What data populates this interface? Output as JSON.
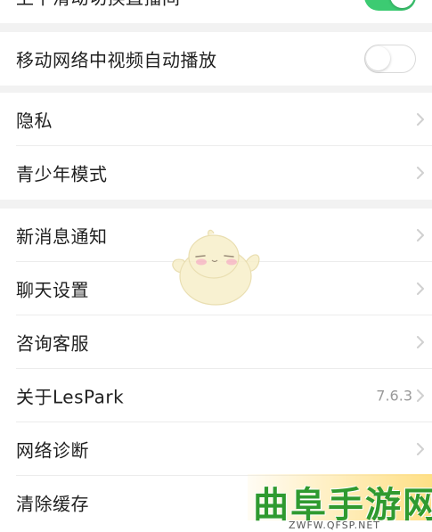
{
  "settings": {
    "top_toggle": {
      "label": "上下滑动切换直播间",
      "state": "on"
    },
    "mobile_autoplay": {
      "label": "移动网络中视频自动播放",
      "state": "off"
    },
    "privacy": {
      "label": "隐私"
    },
    "teen_mode": {
      "label": "青少年模式"
    },
    "new_message": {
      "label": "新消息通知"
    },
    "chat_settings": {
      "label": "聊天设置"
    },
    "support": {
      "label": "咨询客服"
    },
    "about": {
      "label": "关于LesPark",
      "version": "7.6.3"
    },
    "network": {
      "label": "网络诊断"
    },
    "cache": {
      "label": "清除缓存"
    }
  },
  "icons": {
    "chevron": "chevron-right-icon",
    "toggle_on_color": "#3ccb72"
  },
  "watermark": {
    "title": "曲阜手游网",
    "url": "ZWFW.QFSP.NET"
  }
}
